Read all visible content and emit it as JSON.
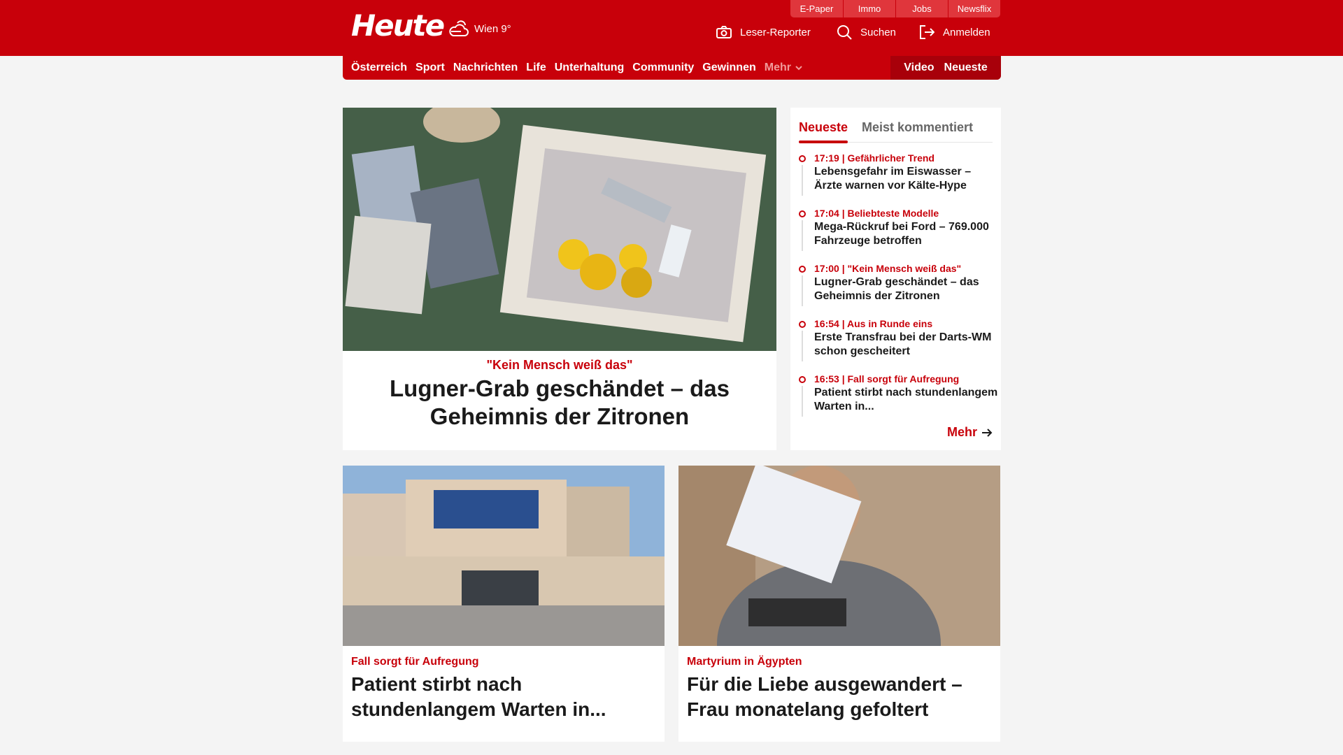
{
  "header": {
    "logo": "Heute",
    "weather": {
      "city_temp": "Wien 9°",
      "icon": "cloud-sun-icon"
    },
    "top_links": [
      "E-Paper",
      "Immo",
      "Jobs",
      "Newsflix"
    ],
    "actions": {
      "leser_reporter": "Leser-Reporter",
      "search": "Suchen",
      "login": "Anmelden"
    },
    "colors": {
      "brand": "#c8000a",
      "brand_dark": "#a8000a"
    }
  },
  "nav": {
    "items": [
      "Österreich",
      "Sport",
      "Nachrichten",
      "Life",
      "Unterhaltung",
      "Community",
      "Gewinnen"
    ],
    "more": "Mehr",
    "right": [
      "Video",
      "Neueste"
    ]
  },
  "hero": {
    "kicker": "\"Kein Mensch weiß das\"",
    "title": "Lugner-Grab geschändet – das Geheimnis der Zitronen"
  },
  "sidebar": {
    "tabs": [
      "Neueste",
      "Meist kommentiert"
    ],
    "items": [
      {
        "meta": "17:19 | Gefährlicher Trend",
        "title": "Lebensgefahr im Eiswasser – Ärzte warnen vor Kälte-Hype"
      },
      {
        "meta": "17:04 | Beliebteste Modelle",
        "title": "Mega-Rückruf bei Ford – 769.000 Fahrzeuge betroffen"
      },
      {
        "meta": "17:00 | \"Kein Mensch weiß das\"",
        "title": "Lugner-Grab geschändet – das Geheimnis der Zitronen"
      },
      {
        "meta": "16:54 | Aus in Runde eins",
        "title": "Erste Transfrau bei der Darts-WM schon gescheitert"
      },
      {
        "meta": "16:53 | Fall sorgt für Aufregung",
        "title": "Patient stirbt nach stundenlangem Warten in..."
      }
    ],
    "more": "Mehr"
  },
  "cards": [
    {
      "kicker": "Fall sorgt für Aufregung",
      "title": "Patient stirbt nach stundenlangem Warten in..."
    },
    {
      "kicker": "Martyrium in Ägypten",
      "title": "Für die Liebe ausgewandert – Frau monatelang gefoltert"
    }
  ]
}
